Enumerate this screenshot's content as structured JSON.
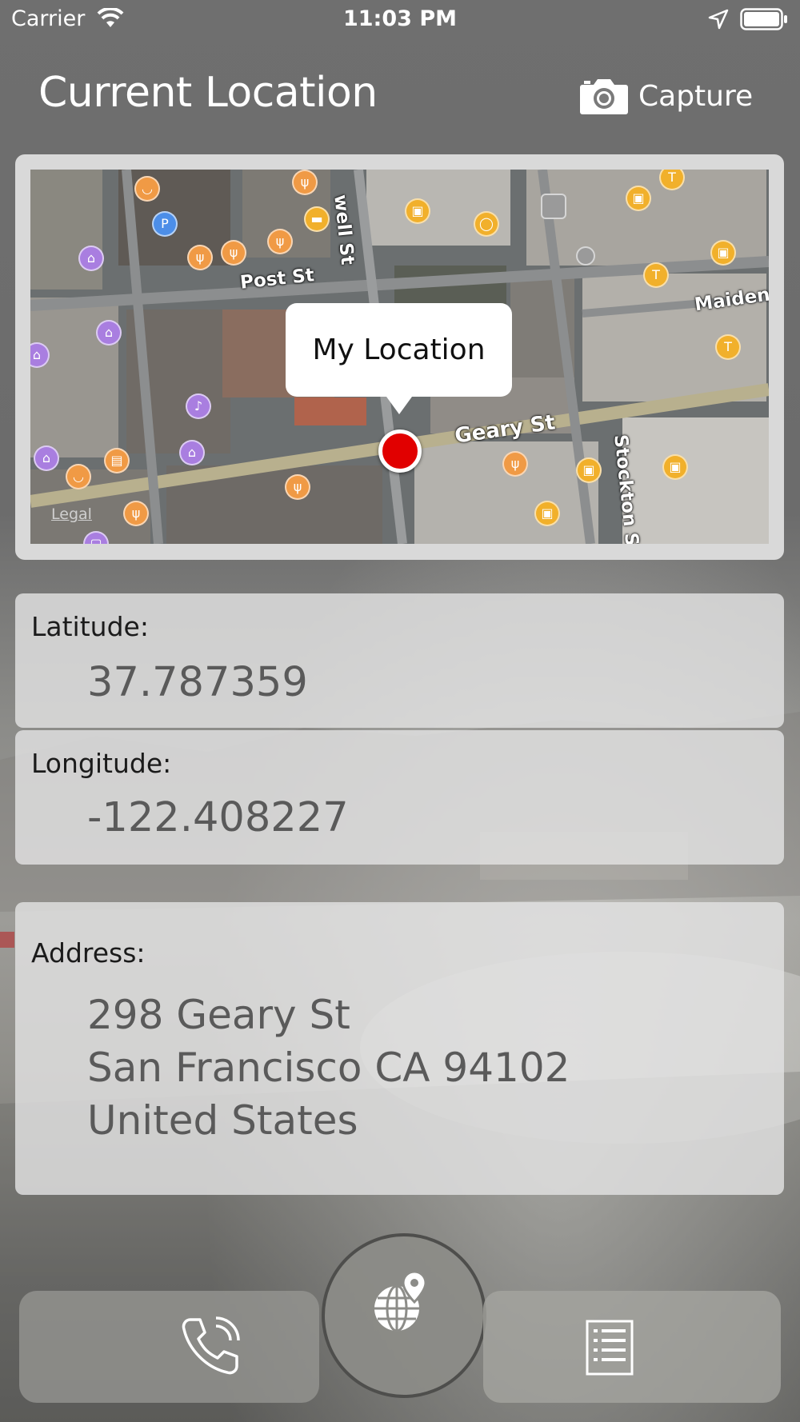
{
  "status_bar": {
    "carrier": "Carrier",
    "time": "11:03 PM",
    "icons": [
      "wifi-icon",
      "location-arrow-icon",
      "battery-icon"
    ]
  },
  "header": {
    "title": "Current Location",
    "capture_label": "Capture",
    "capture_icon": "camera-icon"
  },
  "map": {
    "callout": "My Location",
    "legal": "Legal",
    "streets": [
      "Post St",
      "Geary St",
      "Stockton St",
      "Maiden",
      "well St"
    ],
    "pin_color": "#e10000"
  },
  "coordinates": {
    "latitude_label": "Latitude:",
    "latitude_value": "37.787359",
    "longitude_label": "Longitude:",
    "longitude_value": "-122.408227"
  },
  "address": {
    "label": "Address:",
    "line1": "298 Geary St",
    "line2": "San Francisco CA 94102",
    "line3": "United States"
  },
  "tab_bar": {
    "items": [
      {
        "icon": "phone-icon"
      },
      {
        "icon": "globe-location-icon"
      },
      {
        "icon": "list-document-icon"
      }
    ]
  }
}
